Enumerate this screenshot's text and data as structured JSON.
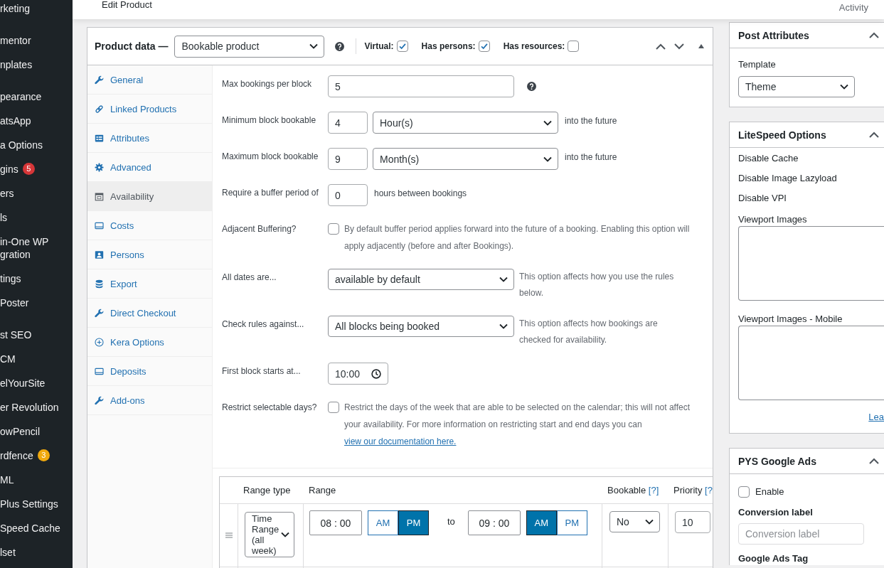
{
  "admin_menu": {
    "groups": [
      {
        "items": [
          {
            "label": "rketing"
          }
        ]
      },
      {
        "items": [
          {
            "label": "mentor"
          },
          {
            "label": "nplates"
          }
        ]
      },
      {
        "items": [
          {
            "label": "pearance"
          },
          {
            "label": "atsApp"
          },
          {
            "label": "a Options"
          },
          {
            "label": "gins",
            "badge": {
              "count": "5",
              "color": "#d63638"
            }
          },
          {
            "label": "ers"
          },
          {
            "label": "ls"
          },
          {
            "label": "in-One WP gration"
          },
          {
            "label": "tings"
          },
          {
            "label": "Poster"
          }
        ]
      },
      {
        "items": [
          {
            "label": "st SEO"
          },
          {
            "label": "CM"
          },
          {
            "label": "elYourSite"
          },
          {
            "label": "er Revolution"
          },
          {
            "label": "owPencil"
          },
          {
            "label": "rdfence",
            "badge": {
              "count": "3",
              "color": "#f0a90e"
            }
          },
          {
            "label": "ML"
          },
          {
            "label": "Plus Settings"
          },
          {
            "label": "Speed Cache"
          },
          {
            "label": "lset"
          }
        ]
      }
    ]
  },
  "header": {
    "title": "Edit Product",
    "activity": "Activity"
  },
  "product_data": {
    "title": "Product data —",
    "type_select": "Bookable product",
    "options": [
      {
        "label": "Virtual:",
        "checked": true
      },
      {
        "label": "Has persons:",
        "checked": true
      },
      {
        "label": "Has resources:",
        "checked": false
      }
    ],
    "tabs": [
      {
        "label": "General",
        "selected": false
      },
      {
        "label": "Linked Products",
        "selected": false
      },
      {
        "label": "Attributes",
        "selected": false
      },
      {
        "label": "Advanced",
        "selected": false
      },
      {
        "label": "Availability",
        "selected": true
      },
      {
        "label": "Costs",
        "selected": false
      },
      {
        "label": "Persons",
        "selected": false
      },
      {
        "label": "Export",
        "selected": false
      },
      {
        "label": "Direct Checkout",
        "selected": false
      },
      {
        "label": "Kera Options",
        "selected": false
      },
      {
        "label": "Deposits",
        "selected": false
      },
      {
        "label": "Add-ons",
        "selected": false
      }
    ],
    "fields": [
      {
        "kind": "number_help",
        "label": "Max bookings per block",
        "value": "5"
      },
      {
        "kind": "number_unit",
        "label": "Minimum block bookable",
        "value": "4",
        "unit": "Hour(s)",
        "suffix": "into the future"
      },
      {
        "kind": "number_unit",
        "label": "Maximum block bookable",
        "value": "9",
        "unit": "Month(s)",
        "suffix": "into the future"
      },
      {
        "kind": "number_suffix",
        "label": "Require a buffer period of",
        "value": "0",
        "suffix": "hours between bookings"
      },
      {
        "kind": "checkbox",
        "label": "Adjacent Buffering?",
        "checked": false,
        "description": "By default buffer period applies forward into the future of a booking. Enabling this option will apply adjacently (before and after Bookings)."
      },
      {
        "kind": "select_desc",
        "label": "All dates are...",
        "value": "available by default",
        "description": "This option affects how you use the rules below."
      },
      {
        "kind": "select_desc",
        "label": "Check rules against...",
        "value": "All blocks being booked",
        "description": "This option affects how bookings are checked for availability."
      },
      {
        "kind": "time",
        "label": "First block starts at...",
        "value": "10:00"
      },
      {
        "kind": "checkbox",
        "label": "Restrict selectable days?",
        "checked": false,
        "description": "Restrict the days of the week that are able to be selected on the calendar; this will not affect your availability. For more information on restricting start and end days you can",
        "link": "view our documentation here."
      }
    ],
    "rules_table": {
      "columns": [
        {
          "label": "Range type"
        },
        {
          "label": "Range"
        },
        {
          "label": "Bookable",
          "help": "[?]"
        },
        {
          "label": "Priority",
          "help": "[?"
        }
      ],
      "rows": [
        {
          "range_type": "Time Range (all week)",
          "from": {
            "value": "08 : 00",
            "ampm": [
              {
                "label": "AM",
                "selected": false
              },
              {
                "label": "PM",
                "selected": true
              }
            ]
          },
          "to_label": "to",
          "to": {
            "value": "09 : 00",
            "ampm": [
              {
                "label": "AM",
                "selected": true
              },
              {
                "label": "PM",
                "selected": false
              }
            ]
          },
          "bookable": "No",
          "priority": "10"
        }
      ]
    }
  },
  "post_attributes": {
    "title": "Post Attributes",
    "template_label": "Template",
    "template_value": "Theme"
  },
  "litespeed_options": {
    "title": "LiteSpeed Options",
    "items": [
      "Disable Cache",
      "Disable Image Lazyload",
      "Disable VPI"
    ],
    "textareas": [
      {
        "label": "Viewport Images"
      },
      {
        "label": "Viewport Images - Mobile"
      }
    ],
    "link": "Lea"
  },
  "google_ads": {
    "title": "PYS Google Ads",
    "enable": {
      "label": "Enable",
      "checked": false
    },
    "conversion": {
      "label": "Conversion label",
      "placeholder": "Conversion label"
    },
    "tag_label": "Google Ads Tag"
  }
}
